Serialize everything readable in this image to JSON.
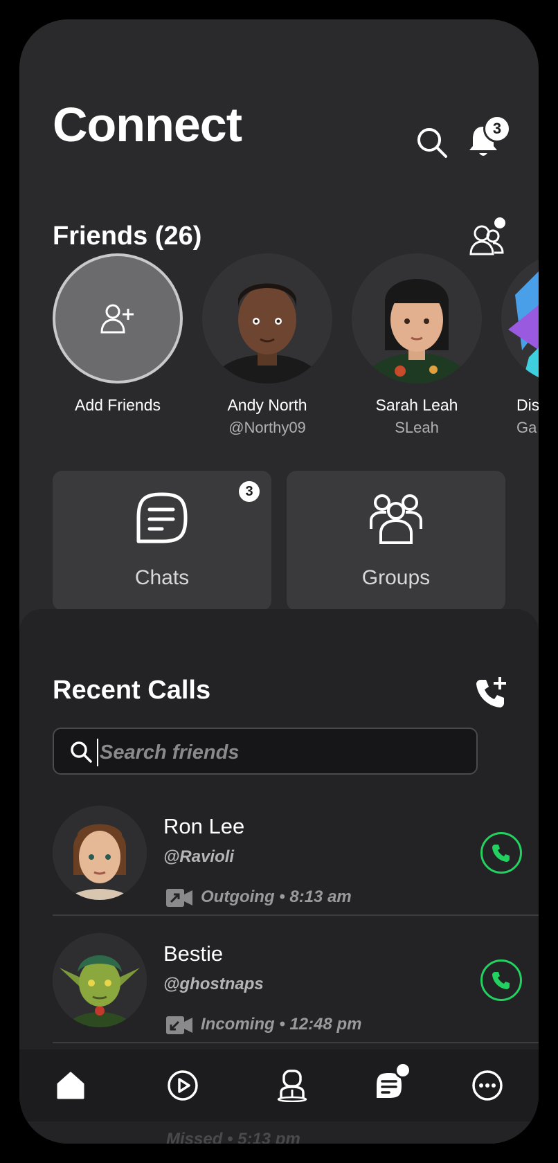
{
  "header": {
    "title": "Connect",
    "notifications_count": "3"
  },
  "friends": {
    "title": "Friends (26)",
    "add_label": "Add Friends",
    "list": [
      {
        "name": "Andy North",
        "handle": "@Northy09"
      },
      {
        "name": "Sarah Leah",
        "handle": "SLeah"
      },
      {
        "name": "Dis",
        "handle": "Ga"
      }
    ]
  },
  "tiles": {
    "chats_label": "Chats",
    "chats_badge": "3",
    "groups_label": "Groups"
  },
  "recent_calls": {
    "title": "Recent Calls",
    "search_placeholder": "Search friends",
    "calls": [
      {
        "name": "Ron Lee",
        "handle": "@Ravioli",
        "meta": "Outgoing • 8:13 am",
        "direction": "outgoing"
      },
      {
        "name": "Bestie",
        "handle": "@ghostnaps",
        "meta": "Incoming • 12:48 pm",
        "direction": "incoming"
      },
      {
        "meta": "Missed • 5:13 pm",
        "direction": "missed"
      }
    ]
  },
  "colors": {
    "background": "#2a2a2c",
    "sheet": "#232325",
    "call_accent": "#23d160",
    "tile": "#3a3a3d"
  }
}
